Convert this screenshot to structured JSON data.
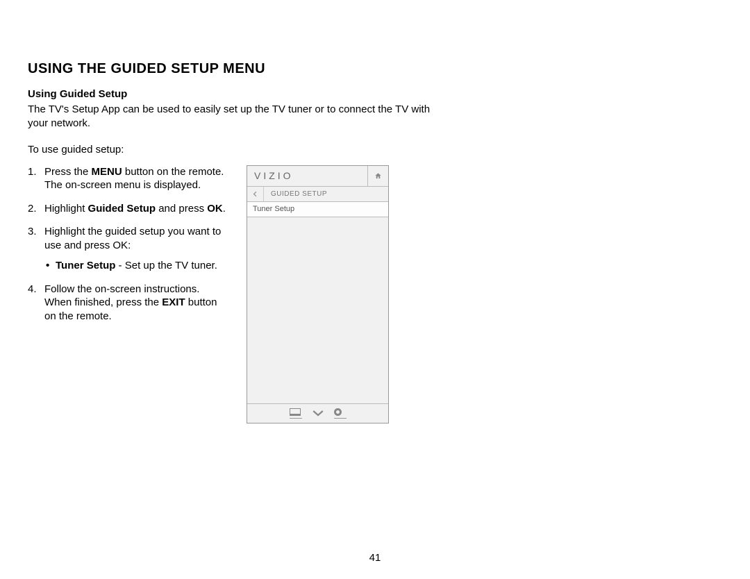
{
  "section_title": "USING THE GUIDED SETUP MENU",
  "subsection_title": "Using Guided Setup",
  "intro": "The TV's Setup App can be used to easily set up the TV tuner or to connect the TV with your network.",
  "lead": "To use guided setup:",
  "steps": {
    "s1_pre": "Press the ",
    "s1_bold": "MENU",
    "s1_post": " button on the remote. The on-screen menu is displayed.",
    "s2_pre": "Highlight ",
    "s2_bold1": "Guided Setup",
    "s2_mid": " and press ",
    "s2_bold2": "OK",
    "s2_post": ".",
    "s3": "Highlight the guided setup you want to use and press OK:",
    "s3_sub_bold": "Tuner Setup",
    "s3_sub_post": " - Set up the TV tuner.",
    "s4_pre": "Follow the on-screen instructions. When finished, press the ",
    "s4_bold": "EXIT",
    "s4_post": " button on the remote."
  },
  "menu": {
    "brand": "VIZIO",
    "crumb": "GUIDED SETUP",
    "item": "Tuner Setup"
  },
  "page_number": "41"
}
